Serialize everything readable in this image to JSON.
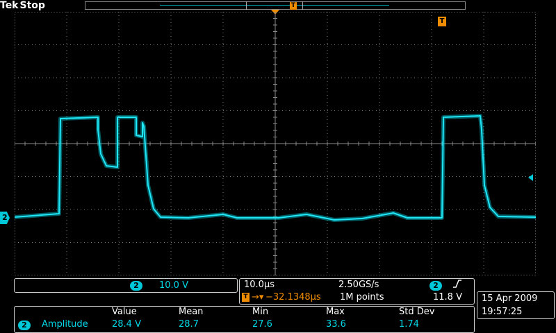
{
  "header": {
    "brand": "Tek",
    "acq_state": "Stop"
  },
  "icons": {
    "trigger": "T",
    "trigger_position": "trigger-position-marker-icon",
    "channel_marker": "2"
  },
  "colors": {
    "channel2": "#00c8d8",
    "trigger": "#f08c00",
    "grid": "#7a7a7a",
    "background": "#000000"
  },
  "channel": {
    "number": "2",
    "scale": "10.0 V"
  },
  "timebase": {
    "horizontal_scale": "10.0µs",
    "sample_rate": "2.50GS/s",
    "trigger_source": "2",
    "trigger_slope_icon": "rising-edge-icon",
    "arrow": "→▾",
    "delay": "−32.1348µs",
    "record_length": "1M points",
    "trigger_level": "11.8 V"
  },
  "measurement": {
    "source": "2",
    "name": "Amplitude",
    "headers": [
      "Value",
      "Mean",
      "Min",
      "Max",
      "Std Dev"
    ],
    "values": [
      "28.4 V",
      "28.7",
      "27.6",
      "33.6",
      "1.74"
    ]
  },
  "datetime": {
    "date": "15 Apr 2009",
    "time": "19:57:25"
  }
}
